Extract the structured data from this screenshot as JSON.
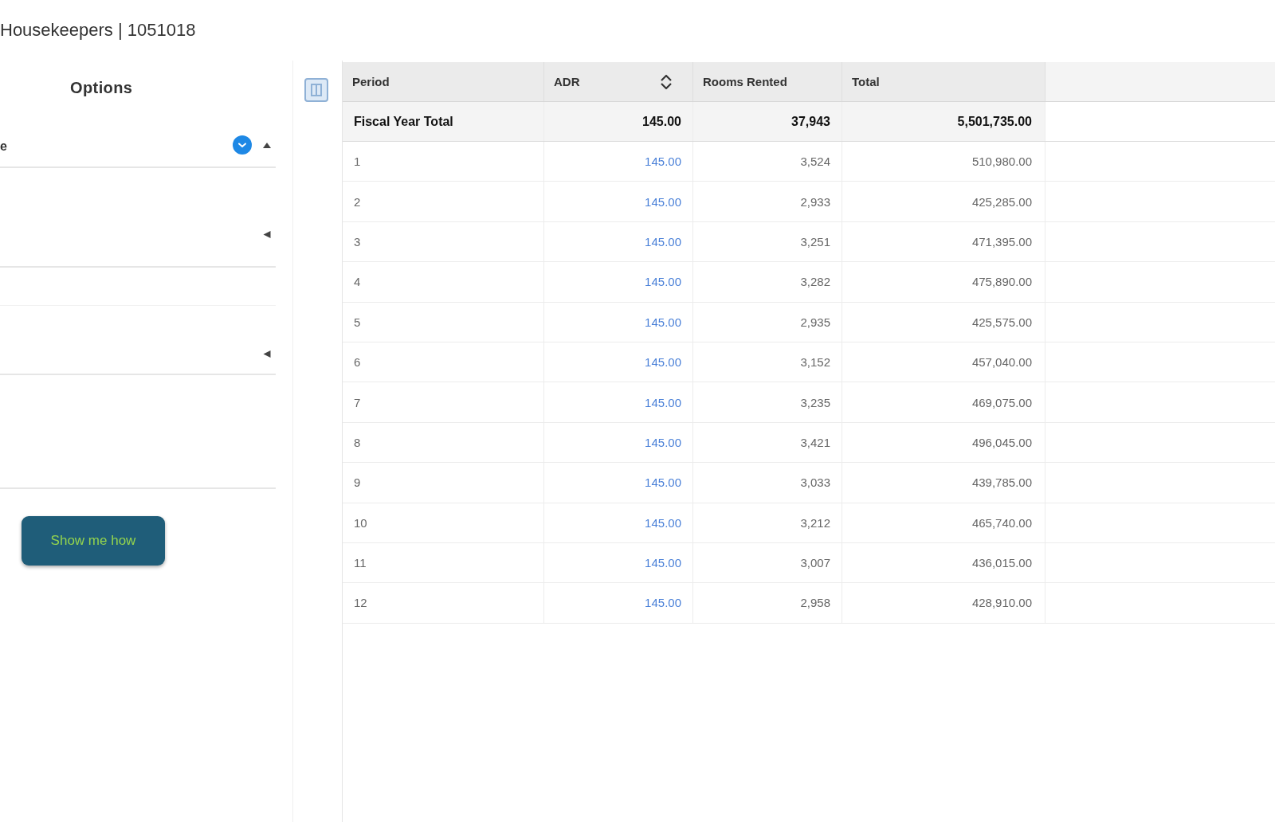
{
  "page": {
    "title": "Housekeepers | 1051018"
  },
  "options_panel": {
    "title": "Options",
    "fields": [
      {
        "kind": "select",
        "value": "e",
        "info": true,
        "expanded": true
      },
      {
        "kind": "select",
        "info": false,
        "expanded": false
      },
      {
        "kind": "input"
      },
      {
        "kind": "select",
        "info": false,
        "expanded": false
      },
      {
        "kind": "textarea"
      }
    ],
    "button": "Show me how"
  },
  "table": {
    "columns": [
      {
        "label": "Period",
        "sortable": false
      },
      {
        "label": "ADR",
        "sortable": true
      },
      {
        "label": "Rooms Rented",
        "sortable": false
      },
      {
        "label": "Total",
        "sortable": false
      }
    ],
    "total_row": {
      "period": "Fiscal Year Total",
      "adr": "145.00",
      "rooms_rented": "37,943",
      "total": "5,501,735.00"
    },
    "rows": [
      {
        "period": "1",
        "adr": "145.00",
        "rooms_rented": "3,524",
        "total": "510,980.00"
      },
      {
        "period": "2",
        "adr": "145.00",
        "rooms_rented": "2,933",
        "total": "425,285.00"
      },
      {
        "period": "3",
        "adr": "145.00",
        "rooms_rented": "3,251",
        "total": "471,395.00"
      },
      {
        "period": "4",
        "adr": "145.00",
        "rooms_rented": "3,282",
        "total": "475,890.00"
      },
      {
        "period": "5",
        "adr": "145.00",
        "rooms_rented": "2,935",
        "total": "425,575.00"
      },
      {
        "period": "6",
        "adr": "145.00",
        "rooms_rented": "3,152",
        "total": "457,040.00"
      },
      {
        "period": "7",
        "adr": "145.00",
        "rooms_rented": "3,235",
        "total": "469,075.00"
      },
      {
        "period": "8",
        "adr": "145.00",
        "rooms_rented": "3,421",
        "total": "496,045.00"
      },
      {
        "period": "9",
        "adr": "145.00",
        "rooms_rented": "3,033",
        "total": "439,785.00"
      },
      {
        "period": "10",
        "adr": "145.00",
        "rooms_rented": "3,212",
        "total": "465,740.00"
      },
      {
        "period": "11",
        "adr": "145.00",
        "rooms_rented": "3,007",
        "total": "436,015.00"
      },
      {
        "period": "12",
        "adr": "145.00",
        "rooms_rented": "2,958",
        "total": "428,910.00"
      }
    ]
  }
}
